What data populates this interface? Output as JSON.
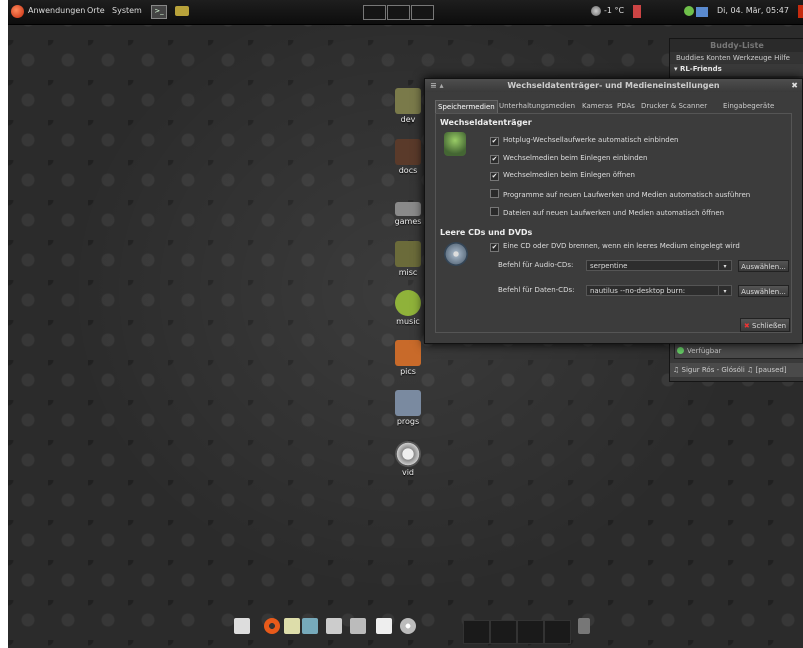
{
  "top_panel": {
    "menu_applications": "Anwendungen",
    "menu_places": "Orte",
    "menu_system": "System",
    "weather": "-1 °C",
    "datetime": "Di, 04. Mär, 05:47"
  },
  "desktop_icons": [
    {
      "label": "dev",
      "color": "#7a7a4a"
    },
    {
      "label": "docs",
      "color": "#5a3a2a"
    },
    {
      "label": "games",
      "color": "#8a8a8a"
    },
    {
      "label": "misc",
      "color": "#6b6b3a"
    },
    {
      "label": "music",
      "color": "#8fb23a"
    },
    {
      "label": "pics",
      "color": "#c86a2a"
    },
    {
      "label": "progs",
      "color": "#7a8aa0"
    },
    {
      "label": "vid",
      "color": "#bbbbbb"
    }
  ],
  "buddy_list": {
    "title": "Buddy-Liste",
    "menu": "Buddies  Konten  Werkzeuge  Hilfe",
    "group": "RL-Friends",
    "status": "Verfügbar",
    "now_playing": "♫ Sigur Rós - Glósóli ♫ [paused]"
  },
  "dialog": {
    "title": "Wechseldatenträger- und Medieneinstellungen",
    "tabs": [
      "Speichermedien",
      "Unterhaltungsmedien",
      "Kameras",
      "PDAs",
      "Drucker & Scanner",
      "Eingabegeräte"
    ],
    "section1": "Wechseldatenträger",
    "checks1": [
      {
        "label": "Hotplug-Wechsellaufwerke automatisch einbinden",
        "checked": true
      },
      {
        "label": "Wechselmedien beim Einlegen einbinden",
        "checked": true
      },
      {
        "label": "Wechselmedien beim Einlegen öffnen",
        "checked": true
      },
      {
        "label": "Programme auf neuen Laufwerken und Medien automatisch ausführen",
        "checked": false
      },
      {
        "label": "Dateien auf neuen Laufwerken und Medien automatisch öffnen",
        "checked": false
      }
    ],
    "section2": "Leere CDs und DVDs",
    "burn_check": {
      "label": "Eine CD oder DVD brennen, wenn ein leeres Medium eingelegt wird",
      "checked": true
    },
    "audio_label": "Befehl für Audio-CDs:",
    "audio_value": "serpentine",
    "data_label": "Befehl für Daten-CDs:",
    "data_value": "nautilus --no-desktop burn:",
    "choose_label": "Auswählen...",
    "close_label": "Schließen"
  }
}
